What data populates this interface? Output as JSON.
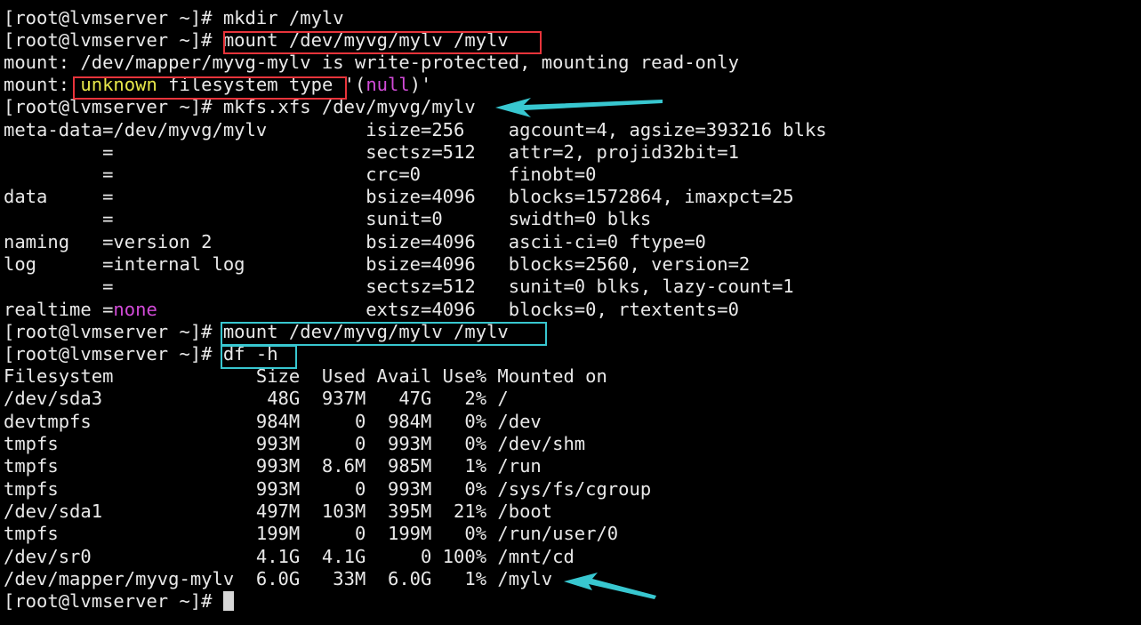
{
  "colors": {
    "background": "#000000",
    "text": "#e9e9e9",
    "highlight_yellow": "#e8e84a",
    "highlight_magenta": "#d24bd8",
    "annotation_red": "#e8343b",
    "annotation_cyan": "#38c7d0"
  },
  "terminal": {
    "prompt": "[root@lvmserver ~]# ",
    "l01_cmd": "mkdir /mylv",
    "l02_cmd": "mount /dev/myvg/mylv /mylv",
    "l03": "mount: /dev/mapper/myvg-mylv is write-protected, mounting read-only",
    "l04_a": "mount: ",
    "l04_b": "unknown",
    "l04_c": " filesystem type '(",
    "l04_d": "null",
    "l04_e": ")'",
    "l05_cmd": "mkfs.xfs /dev/myvg/mylv",
    "l06": "meta-data=/dev/myvg/mylv         isize=256    agcount=4, agsize=393216 blks",
    "l07": "         =                       sectsz=512   attr=2, projid32bit=1",
    "l08": "         =                       crc=0        finobt=0",
    "l09": "data     =                       bsize=4096   blocks=1572864, imaxpct=25",
    "l10": "         =                       sunit=0      swidth=0 blks",
    "l11": "naming   =version 2              bsize=4096   ascii-ci=0 ftype=0",
    "l12": "log      =internal log           bsize=4096   blocks=2560, version=2",
    "l13": "         =                       sectsz=512   sunit=0 blks, lazy-count=1",
    "l14_a": "realtime =",
    "l14_b": "none",
    "l14_c": "                   extsz=4096   blocks=0, rtextents=0",
    "l15_cmd": "mount /dev/myvg/mylv /mylv",
    "l16_cmd": "df -h",
    "l17": "Filesystem             Size  Used Avail Use% Mounted on",
    "l18": "/dev/sda3               48G  937M   47G   2% /",
    "l19": "devtmpfs               984M     0  984M   0% /dev",
    "l20": "tmpfs                  993M     0  993M   0% /dev/shm",
    "l21": "tmpfs                  993M  8.6M  985M   1% /run",
    "l22": "tmpfs                  993M     0  993M   0% /sys/fs/cgroup",
    "l23": "/dev/sda1              497M  103M  395M  21% /boot",
    "l24": "tmpfs                  199M     0  199M   0% /run/user/0",
    "l25": "/dev/sr0               4.1G  4.1G     0 100% /mnt/cd",
    "l26": "/dev/mapper/myvg-mylv  6.0G   33M  6.0G   1% /mylv"
  }
}
